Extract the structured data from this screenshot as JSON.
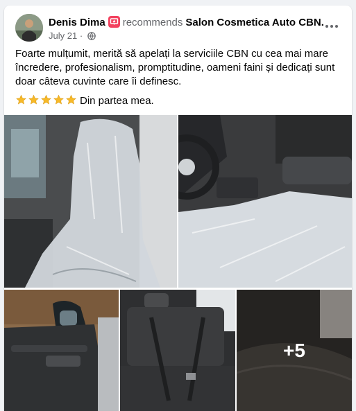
{
  "post": {
    "author": "Denis Dima",
    "recommends_label": "recommends",
    "page_name": "Salon Cosmetica Auto CBN.",
    "date": "July 21",
    "separator": "·",
    "text": "Foarte mulțumit, merită să apelați la serviciile CBN cu cea mai mare încredere, profesionalism, promptitudine, oameni faini și dedicați sunt doar câteva cuvinte care îi definesc.",
    "rating_stars": 5,
    "rating_text": "Din partea mea."
  },
  "icons": {
    "recommend": "recommend-badge-icon",
    "privacy": "globe-icon",
    "menu": "more-options-icon",
    "star": "star-icon"
  },
  "photos": {
    "count_visible": 5,
    "more_label": "+5",
    "items": [
      {
        "name": "photo-seat-plastic-cover-front"
      },
      {
        "name": "photo-dashboard-seat-cover"
      },
      {
        "name": "photo-door-panel"
      },
      {
        "name": "photo-rear-seats"
      },
      {
        "name": "photo-seat-fabric-closeup"
      }
    ]
  },
  "colors": {
    "badge": "#f3425f",
    "star": "#f7b928",
    "meta": "#65676b",
    "card": "#ffffff",
    "background": "#f0f2f5"
  }
}
